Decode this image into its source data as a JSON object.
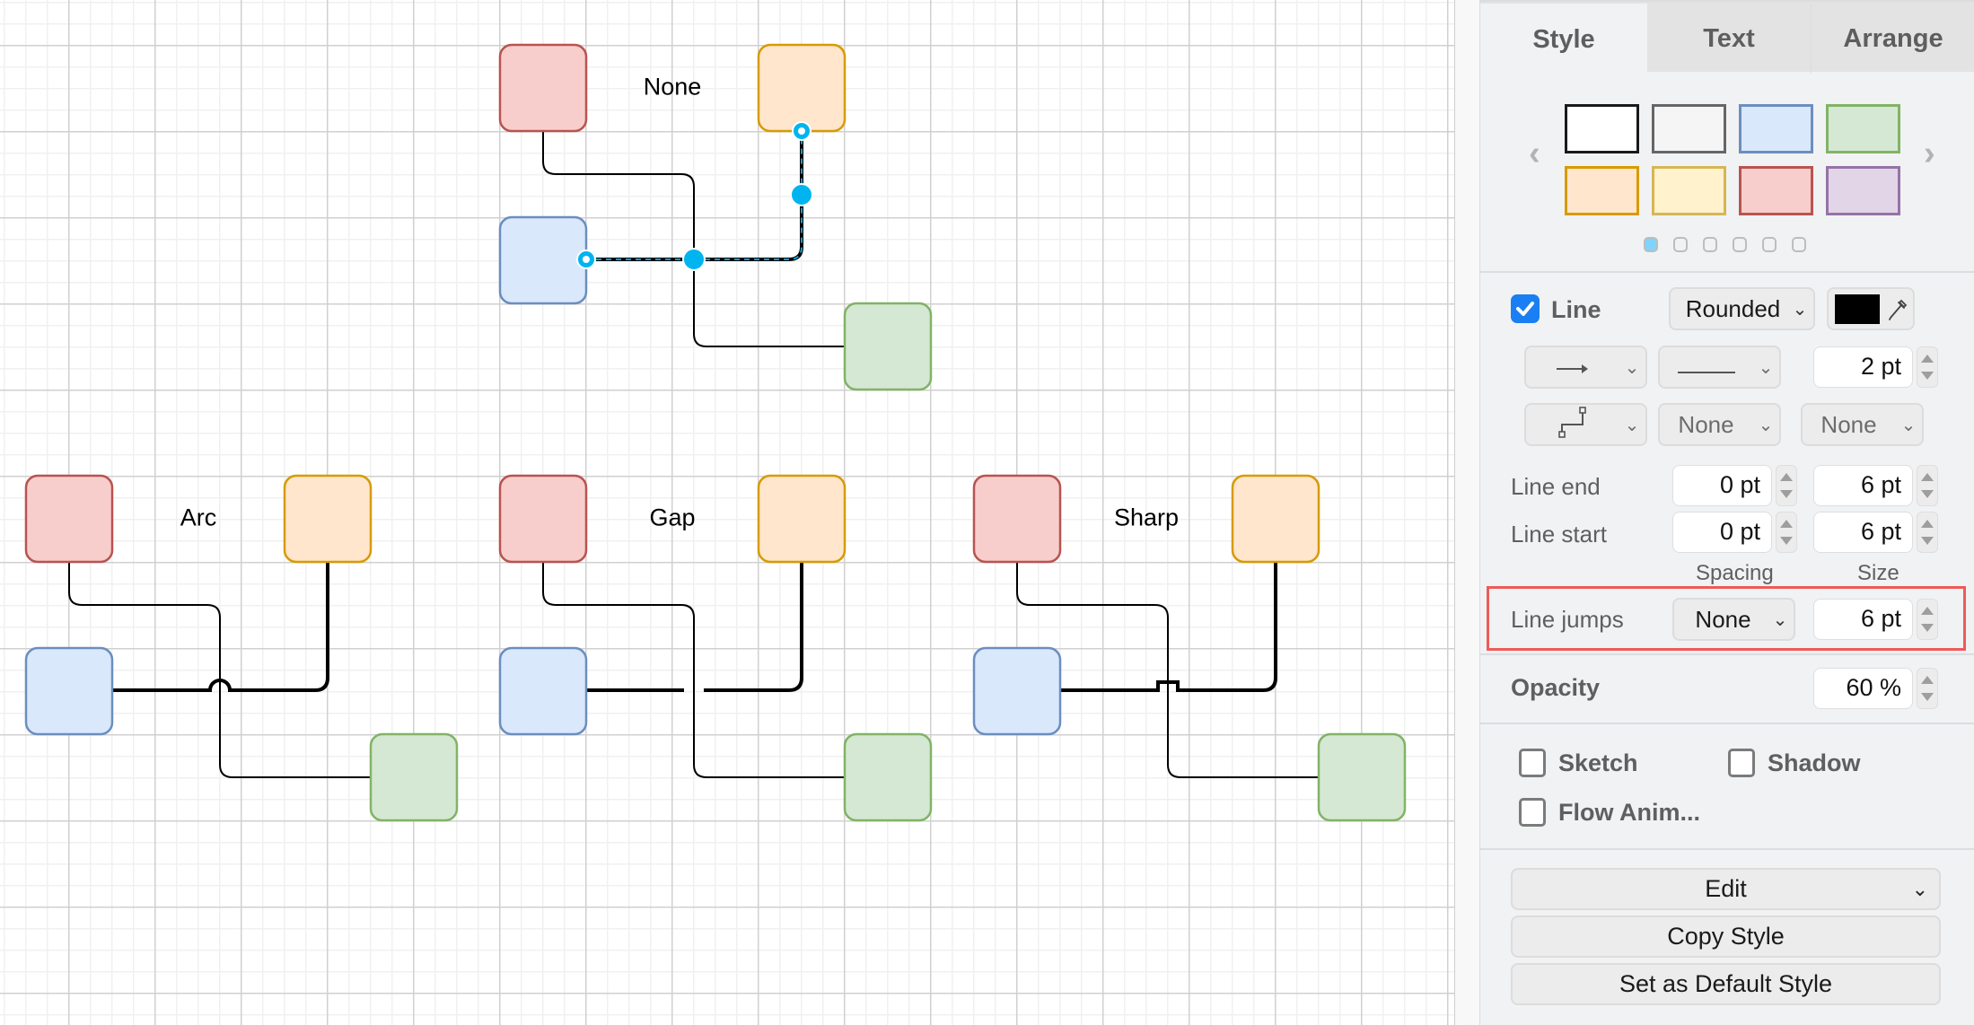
{
  "canvas": {
    "diagrams": [
      {
        "label": "None",
        "jump_style": "none",
        "selected_edge": true
      },
      {
        "label": "Arc",
        "jump_style": "arc",
        "selected_edge": false
      },
      {
        "label": "Gap",
        "jump_style": "gap",
        "selected_edge": false
      },
      {
        "label": "Sharp",
        "jump_style": "sharp",
        "selected_edge": false
      }
    ],
    "shape_colors": {
      "red": {
        "fill": "#f8cecc",
        "stroke": "#b85450"
      },
      "orange": {
        "fill": "#ffe6cc",
        "stroke": "#d79b00"
      },
      "blue": {
        "fill": "#dae8fc",
        "stroke": "#6c8ebf"
      },
      "green": {
        "fill": "#d5e8d4",
        "stroke": "#82b366"
      }
    },
    "selection_color": "#00b4f0"
  },
  "panel": {
    "tabs": [
      {
        "label": "Style",
        "active": true
      },
      {
        "label": "Text",
        "active": false
      },
      {
        "label": "Arrange",
        "active": false
      }
    ],
    "swatches": [
      {
        "fill": "#ffffff",
        "stroke": "#1a1a1a"
      },
      {
        "fill": "#f5f5f5",
        "stroke": "#666666"
      },
      {
        "fill": "#dae8fc",
        "stroke": "#6c8ebf"
      },
      {
        "fill": "#d5e8d4",
        "stroke": "#82b366"
      },
      {
        "fill": "#ffe6cc",
        "stroke": "#d79b00"
      },
      {
        "fill": "#fff2cc",
        "stroke": "#d6b656"
      },
      {
        "fill": "#f8cecc",
        "stroke": "#b85450"
      },
      {
        "fill": "#e1d5e7",
        "stroke": "#9673a6"
      }
    ],
    "swatch_pages": {
      "count": 6,
      "current": 1
    },
    "line": {
      "checkbox_label": "Line",
      "checked": true,
      "style_select": "Rounded",
      "color": "#000000",
      "arrow_icon": "arrow-right-icon",
      "pattern_icon": "solid-line-icon",
      "width": "2 pt",
      "waypoint_icon": "orthogonal-waypoint-icon",
      "line_start_marker": "None",
      "line_end_marker": "None"
    },
    "line_end": {
      "label": "Line end",
      "spacing": "0 pt",
      "size": "6 pt"
    },
    "line_start": {
      "label": "Line start",
      "spacing": "0 pt",
      "size": "6 pt"
    },
    "column_headers": {
      "spacing": "Spacing",
      "size": "Size"
    },
    "line_jumps": {
      "label": "Line jumps",
      "style": "None",
      "size": "6 pt"
    },
    "opacity": {
      "label": "Opacity",
      "value": "60 %"
    },
    "options": [
      {
        "label": "Sketch",
        "checked": false
      },
      {
        "label": "Shadow",
        "checked": false
      },
      {
        "label": "Flow Anim...",
        "checked": false
      }
    ],
    "buttons": {
      "edit": "Edit",
      "copy_style": "Copy Style",
      "set_default": "Set as Default Style"
    },
    "highlight_color": "#ef5a57"
  }
}
